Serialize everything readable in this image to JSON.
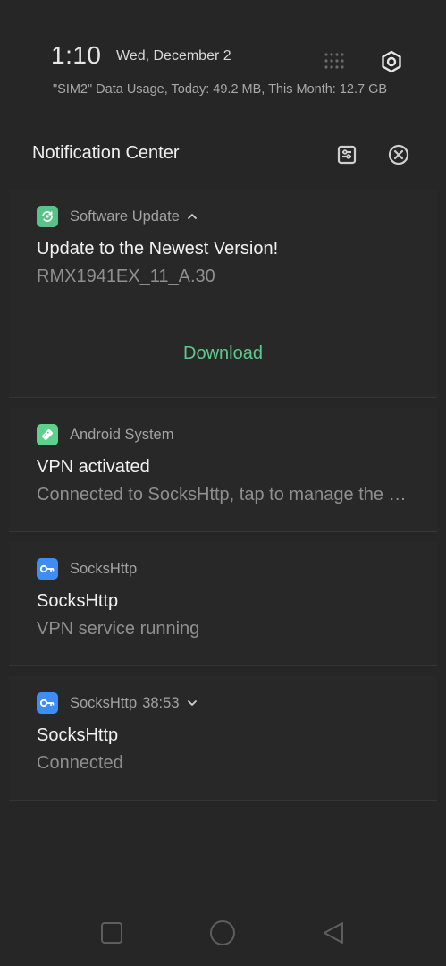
{
  "status": {
    "time": "1:10",
    "date": "Wed, December 2",
    "data_usage": "\"SIM2\" Data Usage, Today: 49.2 MB, This Month: 12.7 GB"
  },
  "notification_center": {
    "title": "Notification Center"
  },
  "notifications": [
    {
      "app": "Software Update",
      "title": "Update to the Newest Version!",
      "text": "RMX1941EX_11_A.30",
      "action": "Download",
      "icon": "software-update-icon",
      "expanded": true
    },
    {
      "app": "Android System",
      "title": "VPN activated",
      "text": "Connected to SocksHttp, tap to manage the network.",
      "icon": "android-system-icon"
    },
    {
      "app": "SocksHttp",
      "title": "SocksHttp",
      "text": "VPN service running",
      "icon": "key-icon"
    },
    {
      "app": "SocksHttp",
      "time": "38:53",
      "title": "SocksHttp",
      "text": "Connected",
      "icon": "key-icon",
      "expanded": false
    }
  ],
  "navigation": {
    "buttons": [
      "recents-icon",
      "home-icon",
      "back-icon"
    ]
  },
  "colors": {
    "background": "#262626",
    "accent_green": "#5fc98a",
    "key_icon_blue": "#3d8df5"
  }
}
